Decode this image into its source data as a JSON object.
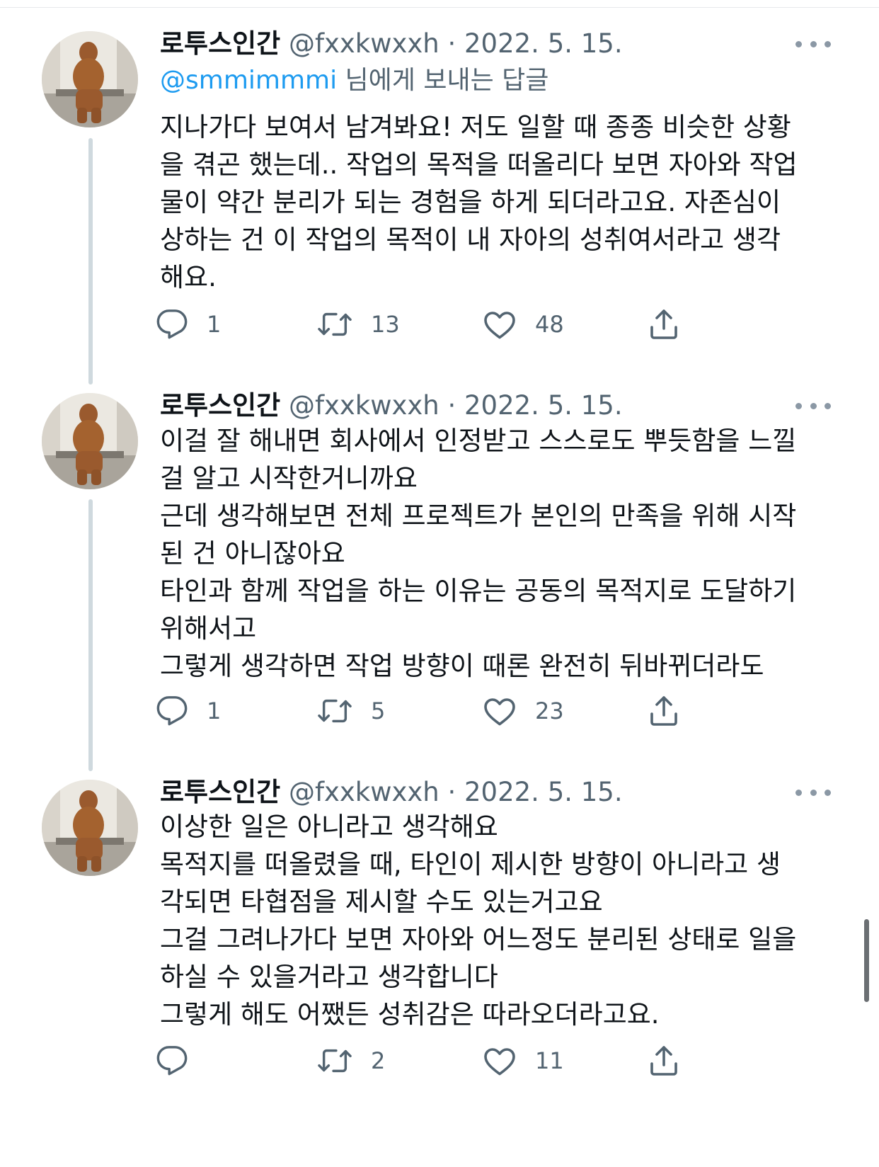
{
  "tweets": [
    {
      "author": "로투스인간",
      "handle": "@fxxkwxxh",
      "separator": "·",
      "date": "2022. 5. 15.",
      "reply_to": {
        "mention": "@smmimmmi",
        "suffix": " 님에게 보내는 답글"
      },
      "lines": [
        "지나가다 보여서 남겨봐요! 저도 일할 때 종종 비슷한 상황",
        "을 겪곤 했는데.. 작업의 목적을 떠올리다 보면 자아와 작업",
        "물이 약간 분리가 되는 경험을 하게 되더라고요. 자존심이",
        "상하는 건 이 작업의 목적이 내 자아의 성취여서라고 생각",
        "해요."
      ],
      "replies": "1",
      "retweets": "13",
      "likes": "48"
    },
    {
      "author": "로투스인간",
      "handle": "@fxxkwxxh",
      "separator": "·",
      "date": "2022. 5. 15.",
      "lines": [
        "이걸 잘 해내면 회사에서 인정받고 스스로도 뿌듯함을 느낄",
        "걸 알고 시작한거니까요",
        "근데 생각해보면 전체 프로젝트가 본인의 만족을 위해 시작",
        "된 건 아니잖아요",
        "타인과 함께 작업을 하는 이유는 공동의 목적지로 도달하기",
        "위해서고",
        "그렇게 생각하면 작업 방향이 때론 완전히 뒤바뀌더라도"
      ],
      "replies": "1",
      "retweets": "5",
      "likes": "23"
    },
    {
      "author": "로투스인간",
      "handle": "@fxxkwxxh",
      "separator": "·",
      "date": "2022. 5. 15.",
      "lines": [
        "이상한 일은 아니라고 생각해요",
        "목적지를 떠올렸을 때, 타인이 제시한 방향이 아니라고 생",
        "각되면 타협점을 제시할 수도 있는거고요",
        "그걸 그려나가다 보면 자아와 어느정도 분리된 상태로 일을",
        "하실 수 있을거라고 생각합니다",
        "그렇게 해도 어쨌든 성취감은 따라오더라고요."
      ],
      "replies": "",
      "retweets": "2",
      "likes": "11"
    }
  ],
  "icons": {
    "reply": "reply-icon",
    "retweet": "retweet-icon",
    "like": "like-icon",
    "share": "share-icon",
    "more": "more-icon"
  },
  "colors": {
    "accent": "#1d9bf0",
    "text": "#0f1419",
    "secondary": "#536471",
    "thread_line": "#cfd9de"
  }
}
